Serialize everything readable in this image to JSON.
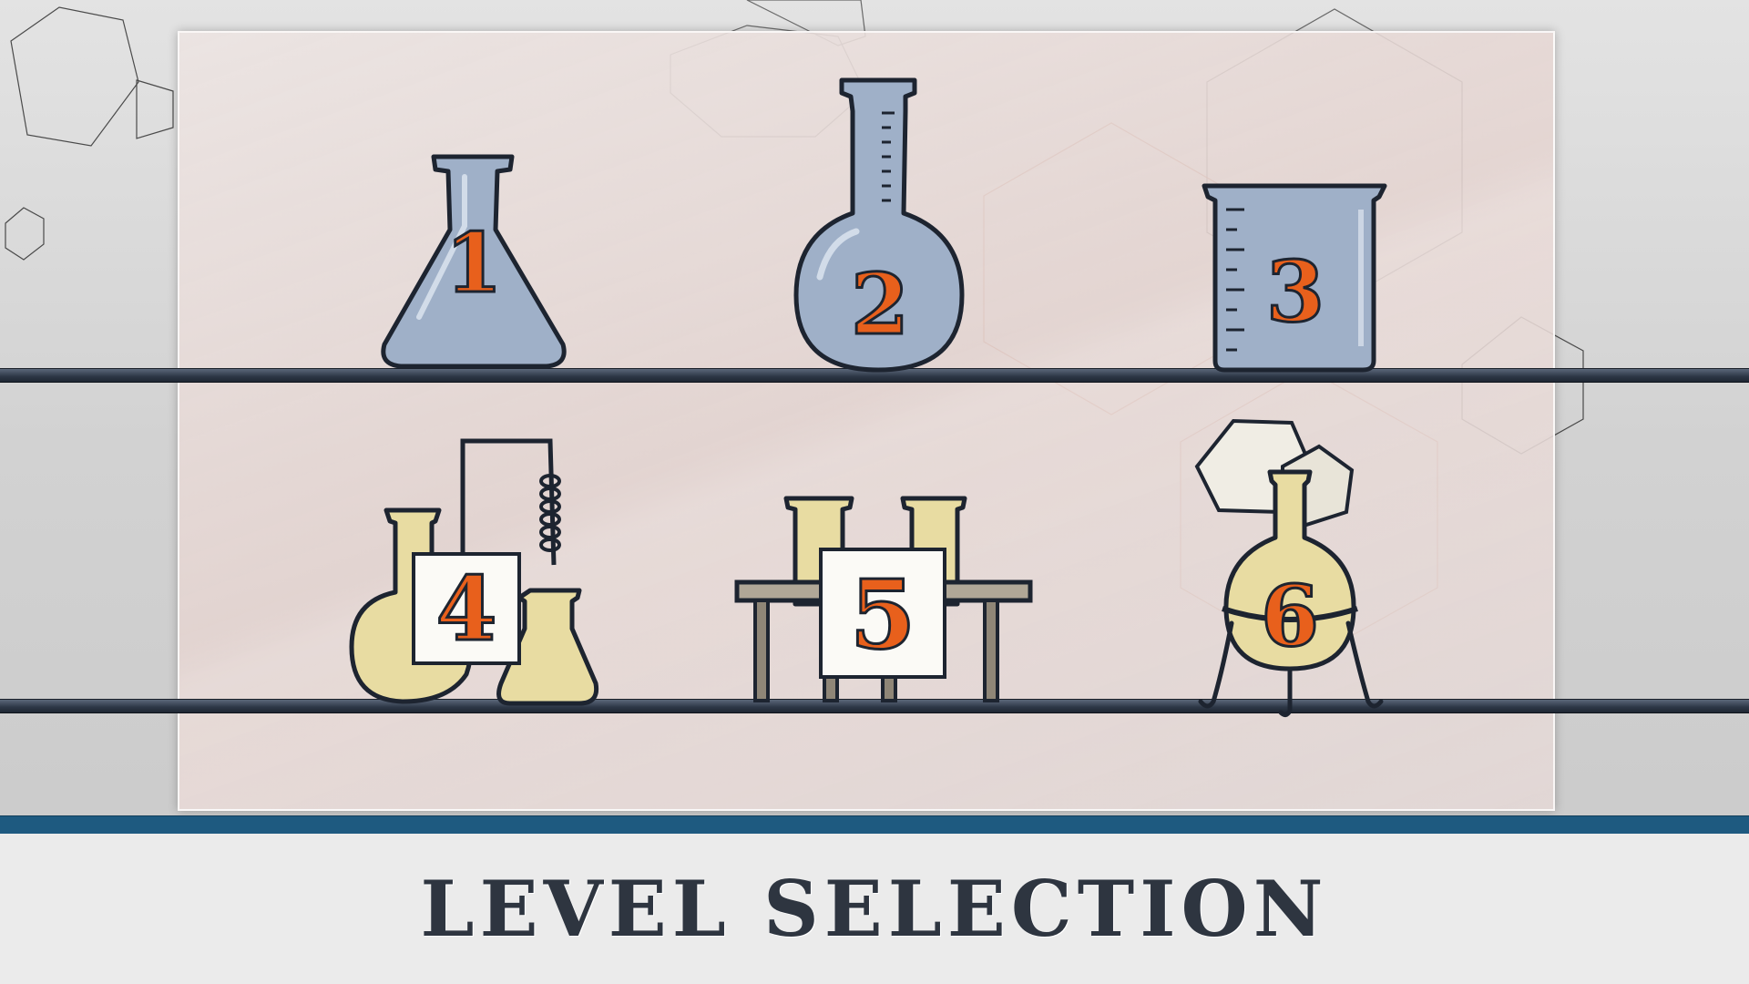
{
  "screen": {
    "title": "LEVEL SELECTION"
  },
  "levels": [
    {
      "number": "1",
      "item": "erlenmeyer-flask"
    },
    {
      "number": "2",
      "item": "volumetric-flask"
    },
    {
      "number": "3",
      "item": "beaker"
    },
    {
      "number": "4",
      "item": "condenser-set"
    },
    {
      "number": "5",
      "item": "test-tube-rack"
    },
    {
      "number": "6",
      "item": "round-flask-stand"
    }
  ],
  "colors": {
    "glass_blue": "#9fb0c8",
    "glass_yellow": "#e8dca2",
    "number_orange": "#e8601c",
    "footer_accent": "#1e5a80",
    "title_text": "#2e3540"
  }
}
